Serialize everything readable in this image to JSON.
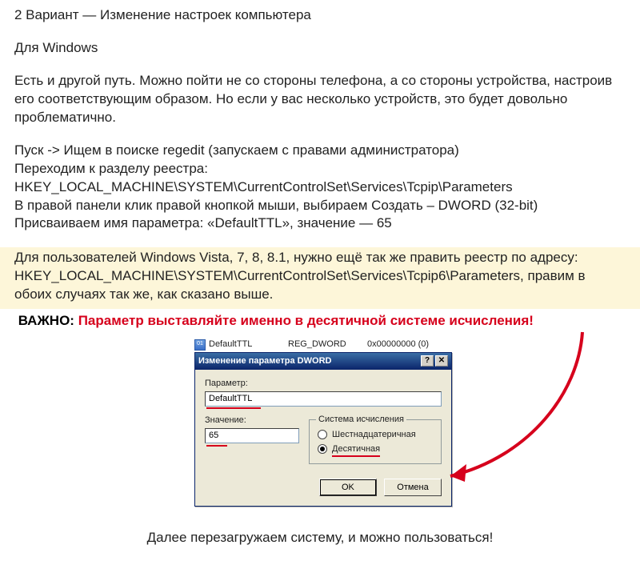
{
  "heading": "2 Вариант — Изменение настроек компьютера",
  "os_label": "Для Windows",
  "intro": "Есть и другой путь. Можно пойти не со стороны телефона, а со стороны устройства, настроив его соответствующим образом. Но если у вас несколько устройств, это будет довольно проблематично.",
  "steps": {
    "l1": "Пуск -> Ищем в поиске regedit (запускаем с правами администратора)",
    "l2": "Переходим к разделу реестра:",
    "l3": "HKEY_LOCAL_MACHINE\\SYSTEM\\CurrentControlSet\\Services\\Tcpip\\Parameters",
    "l4": "В правой панели клик правой кнопкой мыши, выбираем Создать – DWORD (32-bit)",
    "l5": "Присваиваем имя параметра: «DefaultTTL»,  значение — 65"
  },
  "highlight": {
    "l1": "Для пользователей Windows Vista, 7, 8, 8.1, нужно ещё так же править реестр по адресу:",
    "l2": "HKEY_LOCAL_MACHINE\\SYSTEM\\CurrentControlSet\\Services\\Tcpip6\\Parameters, правим в обоих случаях так же, как сказано выше."
  },
  "important": {
    "label": "ВАЖНО:",
    "text": "Параметр выставляйте именно в десятичной системе исчисления!"
  },
  "registry_row": {
    "name": "DefaultTTL",
    "type": "REG_DWORD",
    "value": "0x00000000 (0)"
  },
  "dialog": {
    "title": "Изменение параметра DWORD",
    "help_btn": "?",
    "close_btn": "✕",
    "param_label": "Параметр:",
    "param_value": "DefaultTTL",
    "value_label": "Значение:",
    "value_value": "65",
    "group_legend": "Система исчисления",
    "radio_hex": "Шестнадцатеричная",
    "radio_dec": "Десятичная",
    "ok": "OK",
    "cancel": "Отмена"
  },
  "footer": "Далее перезагружаем систему, и можно пользоваться!"
}
